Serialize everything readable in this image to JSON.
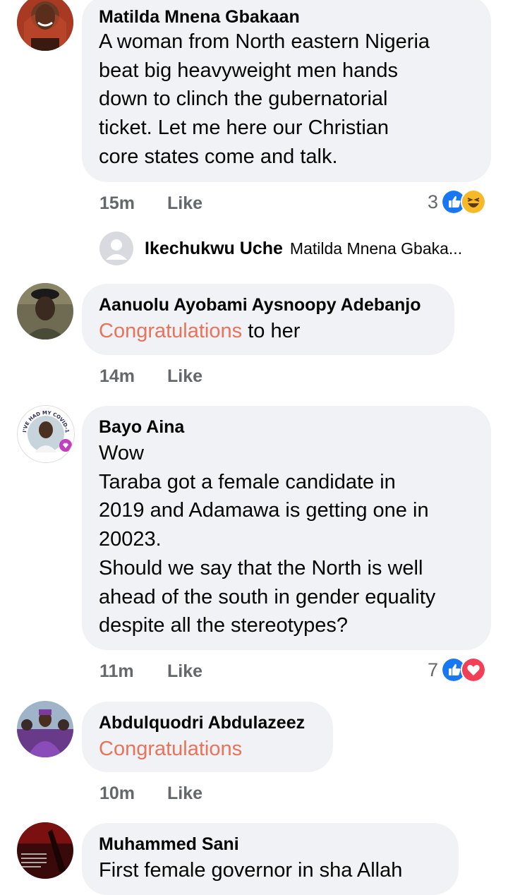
{
  "comments": [
    {
      "author": "Matilda Mnena Gbakaan",
      "lines": "A woman from North eastern Nigeria\nbeat big heavyweight men hands\ndown to clinch the gubernatorial\nticket. Let me here our Christian\ncore states come and talk.",
      "time": "15m",
      "like": "Like",
      "reaction_count": "3"
    },
    {
      "author": "Aanuolu Ayobami Aysnoopy Adebanjo",
      "highlight": "Congratulations",
      "rest": " to her",
      "time": "14m",
      "like": "Like"
    },
    {
      "author": "Bayo Aina",
      "lines": "Wow\nTaraba got a female candidate in\n2019 and Adamawa is getting one in\n20023.\nShould we say that the North is well\nahead of the south in gender equality\ndespite all the stereotypes?",
      "time": "11m",
      "like": "Like",
      "reaction_count": "7"
    },
    {
      "author": "Abdulquodri Abdulazeez",
      "highlight": "Congratulations",
      "time": "10m",
      "like": "Like"
    },
    {
      "author": "Muhammed Sani",
      "lines": "First female governor in sha Allah"
    }
  ],
  "reply_preview": {
    "author": "Ikechukwu Uche",
    "snippet": "Matilda Mnena Gbaka..."
  },
  "avatar_badge_text": "I'VE HAD MY COVID-19 VACCINE",
  "colors": {
    "bubble": "#f0f2f5",
    "highlight": "#e8735a",
    "like_blue": "#1877f2",
    "love_red": "#f33e58",
    "haha_yellow": "#f7b928",
    "meta": "#65676b"
  },
  "icons": [
    "like-reaction-icon",
    "haha-reaction-icon",
    "love-reaction-icon",
    "default-avatar-icon"
  ]
}
